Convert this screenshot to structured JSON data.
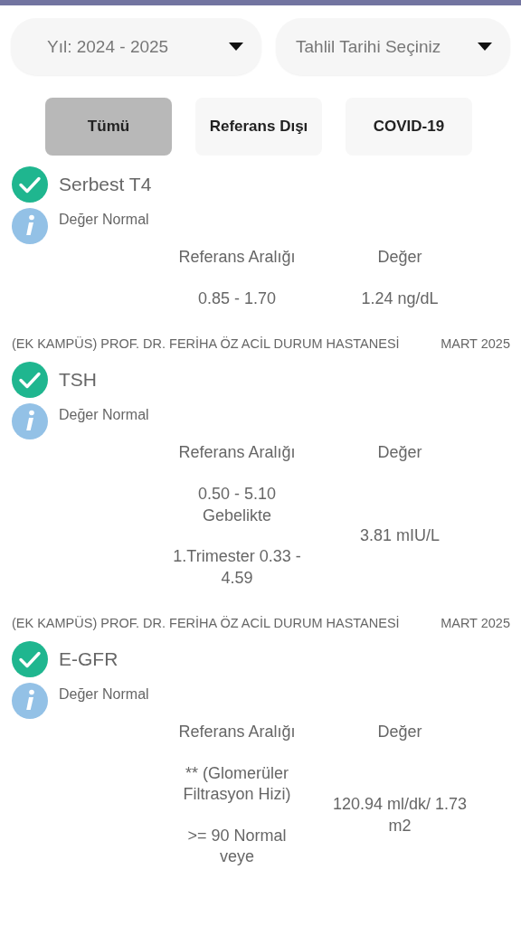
{
  "dropdowns": [
    {
      "value": "Yıl: 2024 - 2025"
    },
    {
      "value": "Tahlil Tarihi Seçiniz"
    }
  ],
  "filters": [
    {
      "label": "Tümü",
      "selected": true
    },
    {
      "label": "Referans Dışı",
      "selected": false
    },
    {
      "label": "COVID-19",
      "selected": false
    }
  ],
  "results": [
    {
      "name": "Serbest T4",
      "checked": true,
      "status": "Değer Normal",
      "reference_header": "Referans Aralığı",
      "value_header": "Değer",
      "reference": [
        "0.85 - 1.70"
      ],
      "value": "1.24 ng/dL",
      "hospital": "(EK KAMPÜS) PROF. DR. FERİHA ÖZ ACİL DURUM HASTANESİ",
      "date": "MART 2025"
    },
    {
      "name": "TSH",
      "checked": true,
      "status": "Değer Normal",
      "reference_header": "Referans Aralığı",
      "value_header": "Değer",
      "reference": [
        "0.50 - 5.10 Gebelikte",
        "1.Trimester   0.33 - 4.59"
      ],
      "value": "3.81 mIU/L",
      "hospital": "(EK KAMPÜS) PROF. DR. FERİHA ÖZ ACİL DURUM HASTANESİ",
      "date": "MART 2025"
    },
    {
      "name": "E-GFR",
      "checked": true,
      "status": "Değer Normal",
      "reference_header": "Referans Aralığı",
      "value_header": "Değer",
      "reference": [
        "** (Glomerüler Filtrasyon Hizi)",
        ">= 90 Normal veye"
      ],
      "value": "120.94 ml/dk/ 1.73 m2"
    }
  ]
}
